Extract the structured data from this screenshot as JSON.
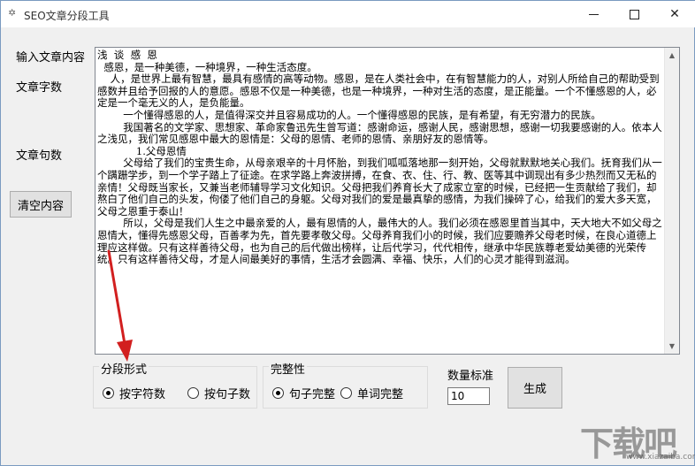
{
  "window": {
    "title": "SEO文章分段工具",
    "icon": "app-icon",
    "controls": {
      "minimize": "minimize-icon",
      "maximize": "maximize-icon",
      "close": "close-icon"
    }
  },
  "sidebar": {
    "input_label": "输入文章内容",
    "char_label": "文章字数",
    "sent_label": "文章句数",
    "clear_button": "清空内容"
  },
  "editor": {
    "content": "浅  谈  感  恩\n  感恩，是一种美德，一种境界，一种生活态度。\n    人，是世界上最有智慧，最具有感情的高等动物。感恩，是在人类社会中，在有智慧能力的人，对别人所给自己的帮助受到感数并且给予回报的人的意愿。感恩不仅是一种美德，也是一种境界，一种对生活的态度，是正能量。一个不懂感恩的人，必定是一个毫无义的人，是负能量。\n        一个懂得感恩的人，是值得深交并且容易成功的人。一个懂得感恩的民族，是有希望，有无穷潜力的民族。\n        我国著名的文学家、思想家、革命家鲁迅先生曾写道：感谢命运，感谢人民，感谢思想，感谢一切我要感谢的人。依本人之浅见，我们常见感恩中最大的恩情是：父母的恩情、老师的恩情、亲朋好友的恩情等。\n            1.父母恩情\n        父母给了我们的宝贵生命，从母亲艰辛的十月怀胎，到我们呱呱落地那一刻开始，父母就默默地关心我们。抚育我们从一个蹒跚学步，到一个学子踏上了征途。在求学路上奔波拼搏，在食、衣、住、行、教、医等其中调现出有多少热烈而又无私的亲情！父母既当家长，又兼当老师辅导学习文化知识。父母把我们养育长大了成家立室的时候，已经把一生贡献给了我们，却熬白了他们自己的头发，佝偻了他们自己的身躯。父母对我们的爱是最真挚的感情，为我们操碎了心，给我们的爱大多天宽，父母之恩重于泰山！\n        所以，父母是我们人生之中最亲爱的人，最有恩情的人，最伟大的人。我们必须在感恩里首当其中，天大地大不如父母之恩情大，懂得先感恩父母，百善孝为先，首先要孝敬父母。父母养育我们小的时候，我们应要赡养父母老时候，在良心道德上理应这样做。只有这样善待父母，也为自己的后代做出榜样，让后代学习，代代相传，继承中华民族尊老爱幼美德的光荣传统。只有这样善待父母，才是人间最美好的事情，生活才会圆满、幸福、快乐，人们的心灵才能得到滋润。"
  },
  "mode_group": {
    "legend": "分段形式",
    "options": [
      {
        "label": "按字符数",
        "selected": true
      },
      {
        "label": "按句子数",
        "selected": false
      }
    ]
  },
  "complete_group": {
    "legend": "完整性",
    "options": [
      {
        "label": "句子完整",
        "selected": true
      },
      {
        "label": "单词完整",
        "selected": false
      }
    ]
  },
  "count": {
    "label": "数量标准",
    "value": "10"
  },
  "generate_button": "生成",
  "watermark": {
    "text": "下载吧",
    "url": "www.xiazaiba.com"
  },
  "colors": {
    "annotation_arrow": "#d21f1f",
    "window_bg": "#f0f0f0"
  }
}
